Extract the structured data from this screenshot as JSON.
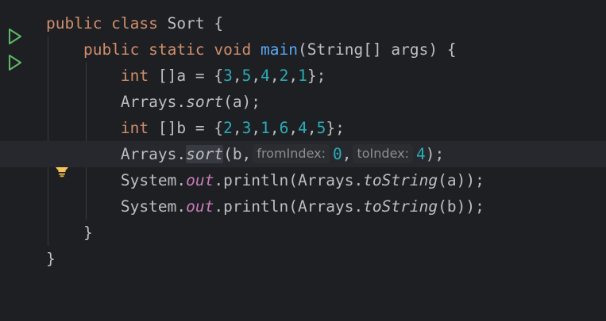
{
  "gutter": {
    "run_icons": [
      "run-class",
      "run-main"
    ],
    "bulb_icon": "lightbulb-icon"
  },
  "code": {
    "line1": {
      "kw": "public class ",
      "name": "Sort",
      "rest": " {"
    },
    "line2": {
      "kw": "public static void ",
      "fn": "main",
      "rest": "(String[] args) {"
    },
    "line3": {
      "kw": "int",
      "t1": " []a = {",
      "n1": "3",
      "c1": ",",
      "n2": "5",
      "c2": ",",
      "n3": "4",
      "c3": ",",
      "n4": "2",
      "c4": ",",
      "n5": "1",
      "end": "};"
    },
    "line4": {
      "obj": "Arrays.",
      "m": "sort",
      "rest": "(a);"
    },
    "line5": {
      "kw": "int",
      "t1": " []b = {",
      "n1": "2",
      "c1": ",",
      "n2": "3",
      "c2": ",",
      "n3": "1",
      "c3": ",",
      "n4": "6",
      "c4": ",",
      "n5": "4",
      "c5": ",",
      "n6": "5",
      "end": "};"
    },
    "line6": {
      "obj": "Arrays.",
      "m": "sort",
      "p1": "(b,",
      "hint1": "fromIndex:",
      "v1": "0",
      "comma": ",",
      "hint2": "toIndex:",
      "v2": "4",
      "end": ");"
    },
    "line7": {
      "obj": "System.",
      "field": "out",
      "mid": ".println(Arrays.",
      "m": "toString",
      "rest": "(a));"
    },
    "line8": {
      "obj": "System.",
      "field": "out",
      "mid": ".println(Arrays.",
      "m": "toString",
      "rest": "(b));"
    },
    "line9": {
      "brace": "}"
    },
    "line10": {
      "brace": "}"
    }
  },
  "colors": {
    "background": "#1e1f22",
    "keyword": "#cf8e6d",
    "function": "#56a8f5",
    "number": "#2aacb8",
    "field": "#c77dbb",
    "text": "#bcbec4"
  }
}
